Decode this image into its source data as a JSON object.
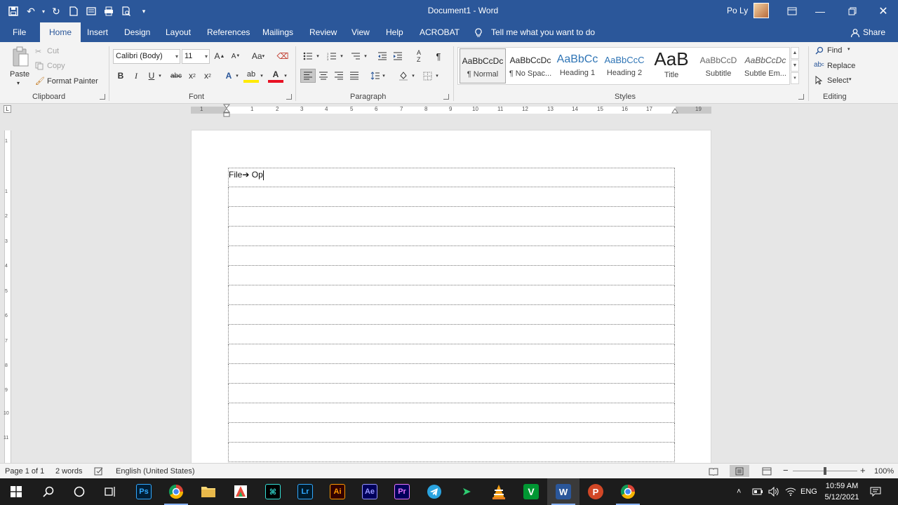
{
  "title_bar": {
    "document_title": "Document1  -  Word",
    "user_name": "Po Ly"
  },
  "menu": {
    "tabs": [
      "File",
      "Home",
      "Insert",
      "Design",
      "Layout",
      "References",
      "Mailings",
      "Review",
      "View",
      "Help",
      "ACROBAT"
    ],
    "active_tab": "Home",
    "tell_me": "Tell me what you want to do",
    "share": "Share"
  },
  "ribbon": {
    "clipboard": {
      "paste": "Paste",
      "cut": "Cut",
      "copy": "Copy",
      "format_painter": "Format Painter",
      "label": "Clipboard"
    },
    "font": {
      "family": "Calibri (Body)",
      "size": "11",
      "label": "Font"
    },
    "paragraph": {
      "label": "Paragraph"
    },
    "styles": {
      "items": [
        {
          "preview": "AaBbCcDc",
          "name": "¶ Normal"
        },
        {
          "preview": "AaBbCcDc",
          "name": "¶ No Spac..."
        },
        {
          "preview": "AaBbCc",
          "name": "Heading 1"
        },
        {
          "preview": "AaBbCcC",
          "name": "Heading 2"
        },
        {
          "preview": "AaB",
          "name": "Title"
        },
        {
          "preview": "AaBbCcD",
          "name": "Subtitle"
        },
        {
          "preview": "AaBbCcDc",
          "name": "Subtle Em..."
        }
      ],
      "label": "Styles"
    },
    "editing": {
      "find": "Find",
      "replace": "Replace",
      "select": "Select",
      "label": "Editing"
    }
  },
  "ruler": {
    "h_numbers": [
      "1",
      "1",
      "2",
      "3",
      "4",
      "5",
      "6",
      "7",
      "8",
      "9",
      "10",
      "11",
      "12",
      "13",
      "14",
      "15",
      "16",
      "17",
      "19"
    ],
    "v_numbers": [
      "1",
      "1",
      "2",
      "3",
      "4",
      "5",
      "6",
      "7",
      "8",
      "9",
      "10",
      "11"
    ]
  },
  "document": {
    "first_cell_text": "File",
    "arrow": "➔",
    "after_arrow": " Op",
    "table_rows": 15
  },
  "status": {
    "page": "Page 1 of 1",
    "words": "2 words",
    "language": "English (United States)",
    "zoom": "100%"
  },
  "taskbar": {
    "lang": "ENG",
    "time": "10:59 AM",
    "date": "5/12/2021"
  },
  "colors": {
    "word_blue": "#2b579a",
    "taskbar": "#1c1c1c"
  }
}
